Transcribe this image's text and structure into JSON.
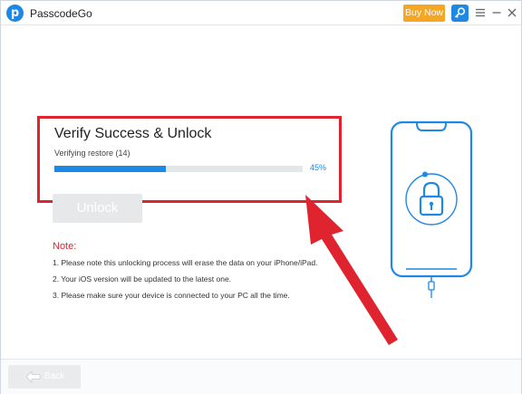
{
  "app": {
    "title": "PasscodeGo",
    "logo_letter": "p",
    "buy_now_label": "Buy Now",
    "icons": {
      "logo": "passcodego-logo-icon",
      "key": "key-icon",
      "menu": "menu-icon",
      "minimize": "minimize-icon",
      "close": "close-icon"
    }
  },
  "verify": {
    "title": "Verify Success & Unlock",
    "status": "Verifying restore (14)",
    "progress_percent": 45,
    "progress_label": "45%"
  },
  "unlock_button_label": "Unlock",
  "note": {
    "title": "Note:",
    "items": [
      "1. Please note this unlocking process will erase the data on your iPhone/iPad.",
      "2. Your iOS version will be updated to the latest one.",
      "3. Please make sure your device is connected to your PC all the time."
    ]
  },
  "footer": {
    "back_label": "Back",
    "back_icon": "back-arrow-icon"
  },
  "colors": {
    "accent": "#1e88e5",
    "buy_now": "#f5a623",
    "highlight_red": "#e0242f",
    "disabled_button": "#e6e8ea",
    "progress_track": "#e4e7ea"
  }
}
